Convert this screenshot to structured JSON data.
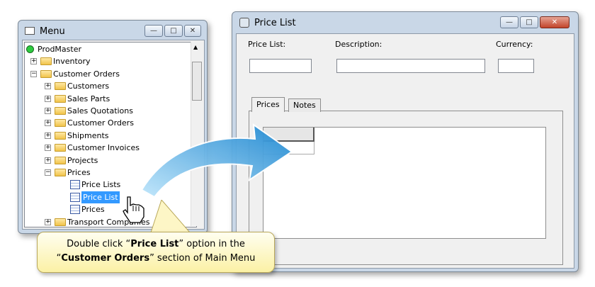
{
  "menu_window": {
    "title": "Menu",
    "buttons": {
      "minimize": "—",
      "maximize": "□",
      "close": "✕"
    },
    "tree": [
      {
        "label": "ProdMaster",
        "icon": "status-icon"
      },
      {
        "label": "Inventory",
        "icon": "folder-icon",
        "expander": "+"
      },
      {
        "label": "Customer Orders",
        "icon": "folder-open-icon",
        "expander": "−"
      },
      {
        "label": "Customers",
        "icon": "folder-icon",
        "expander": "+"
      },
      {
        "label": "Sales Parts",
        "icon": "folder-icon",
        "expander": "+"
      },
      {
        "label": "Sales Quotations",
        "icon": "folder-icon",
        "expander": "+"
      },
      {
        "label": "Customer Orders",
        "icon": "folder-icon",
        "expander": "+"
      },
      {
        "label": "Shipments",
        "icon": "folder-icon",
        "expander": "+"
      },
      {
        "label": "Customer Invoices",
        "icon": "folder-icon",
        "expander": "+"
      },
      {
        "label": "Projects",
        "icon": "folder-icon",
        "expander": "+"
      },
      {
        "label": "Prices",
        "icon": "folder-open-icon",
        "expander": "−"
      },
      {
        "label": "Price Lists",
        "icon": "grid-icon"
      },
      {
        "label": "Price List",
        "icon": "form-icon",
        "selected": true
      },
      {
        "label": "Prices",
        "icon": "grid-icon"
      },
      {
        "label": "Transport Companies",
        "icon": "folder-icon",
        "expander": "+"
      }
    ]
  },
  "price_window": {
    "title": "Price List",
    "buttons": {
      "minimize": "—",
      "maximize": "□",
      "close": "✕"
    },
    "fields": {
      "price_list": "Price List:",
      "description": "Description:",
      "currency": "Currency:"
    },
    "tabs": [
      "Prices",
      "Notes"
    ]
  },
  "callout": {
    "pre1": "Double click “",
    "bold1": "Price List",
    "post1": "” option in the",
    "pre2": "“",
    "bold2": "Customer Orders",
    "post2": "” section of Main Menu"
  },
  "colors": {
    "arrow": "#3aa0dc",
    "selection": "#3399ff",
    "callout_bg": "#fbf1a5"
  }
}
